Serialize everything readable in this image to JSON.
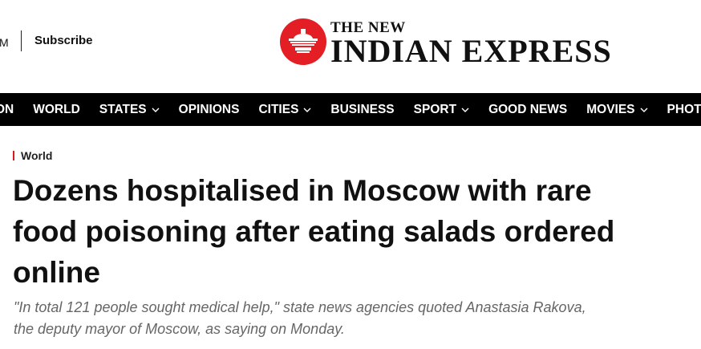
{
  "topbar": {
    "edition_fragment": "M",
    "subscribe_label": "Subscribe"
  },
  "logo": {
    "line1": "THE NEW",
    "line2": "INDIAN EXPRESS",
    "emblem_color": "#e31e24"
  },
  "nav": {
    "items": [
      {
        "label": "ON",
        "has_dropdown": false
      },
      {
        "label": "WORLD",
        "has_dropdown": false
      },
      {
        "label": "STATES",
        "has_dropdown": true
      },
      {
        "label": "OPINIONS",
        "has_dropdown": false
      },
      {
        "label": "CITIES",
        "has_dropdown": true
      },
      {
        "label": "BUSINESS",
        "has_dropdown": false
      },
      {
        "label": "SPORT",
        "has_dropdown": true
      },
      {
        "label": "GOOD NEWS",
        "has_dropdown": false
      },
      {
        "label": "MOVIES",
        "has_dropdown": true
      },
      {
        "label": "PHOTOS",
        "has_dropdown": false
      }
    ]
  },
  "article": {
    "section": "World",
    "headline": "Dozens hospitalised in Moscow with rare food poisoning after eating salads ordered online",
    "standfirst": "\"In total 121 people sought medical help,\" state news agencies quoted Anastasia Rakova, the deputy mayor of Moscow, as saying on Monday."
  },
  "colors": {
    "accent_red": "#d71920",
    "nav_bg": "#000000",
    "nav_text": "#ffffff",
    "standfirst_text": "#666666"
  }
}
